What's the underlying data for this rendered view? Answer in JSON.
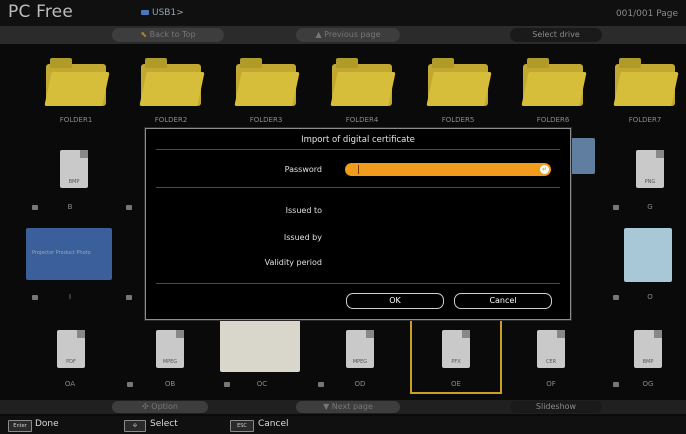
{
  "header": {
    "app_title": "PC Free",
    "drive_path": "USB1>",
    "page_counter": "001/001 Page"
  },
  "top_nav": {
    "back_to_top": "Back to Top",
    "previous_page": "Previous page",
    "select_drive": "Select drive"
  },
  "grid": {
    "row1": [
      "FOLDER1",
      "FOLDER2",
      "FOLDER3",
      "FOLDER4",
      "FOLDER5",
      "FOLDER6",
      "FOLDER7"
    ],
    "row2_left": "B",
    "row2_right": "G",
    "row3_left": "I",
    "row3_right": "O",
    "row4": [
      "OA",
      "OB",
      "OC",
      "OD",
      "OE",
      "OF",
      "OG"
    ],
    "file_ext": {
      "row2_left": "BMP",
      "row2_right": "PNG",
      "oa": "PDF",
      "ob": "MPEG",
      "od": "MPEG",
      "oe": "PFX",
      "of": "CER",
      "og": "BMP"
    },
    "thumb_text": "Projector Product Photo"
  },
  "dialog": {
    "title": "Import of digital certificate",
    "password_label": "Password",
    "password_value": "",
    "issued_to_label": "Issued to",
    "issued_by_label": "Issued by",
    "validity_label": "Validity period",
    "ok_label": "OK",
    "cancel_label": "Cancel"
  },
  "bottom_nav": {
    "option": "Option",
    "next_page": "Next page",
    "slideshow": "Slideshow"
  },
  "footer": {
    "enter_key": "Enter",
    "done": "Done",
    "select": "Select",
    "esc_key": "ESC",
    "cancel": "Cancel"
  },
  "colors": {
    "accent_orange": "#f29c1e",
    "selection_yellow": "#c9a020",
    "folder_yellow": "#d6bd3a"
  }
}
